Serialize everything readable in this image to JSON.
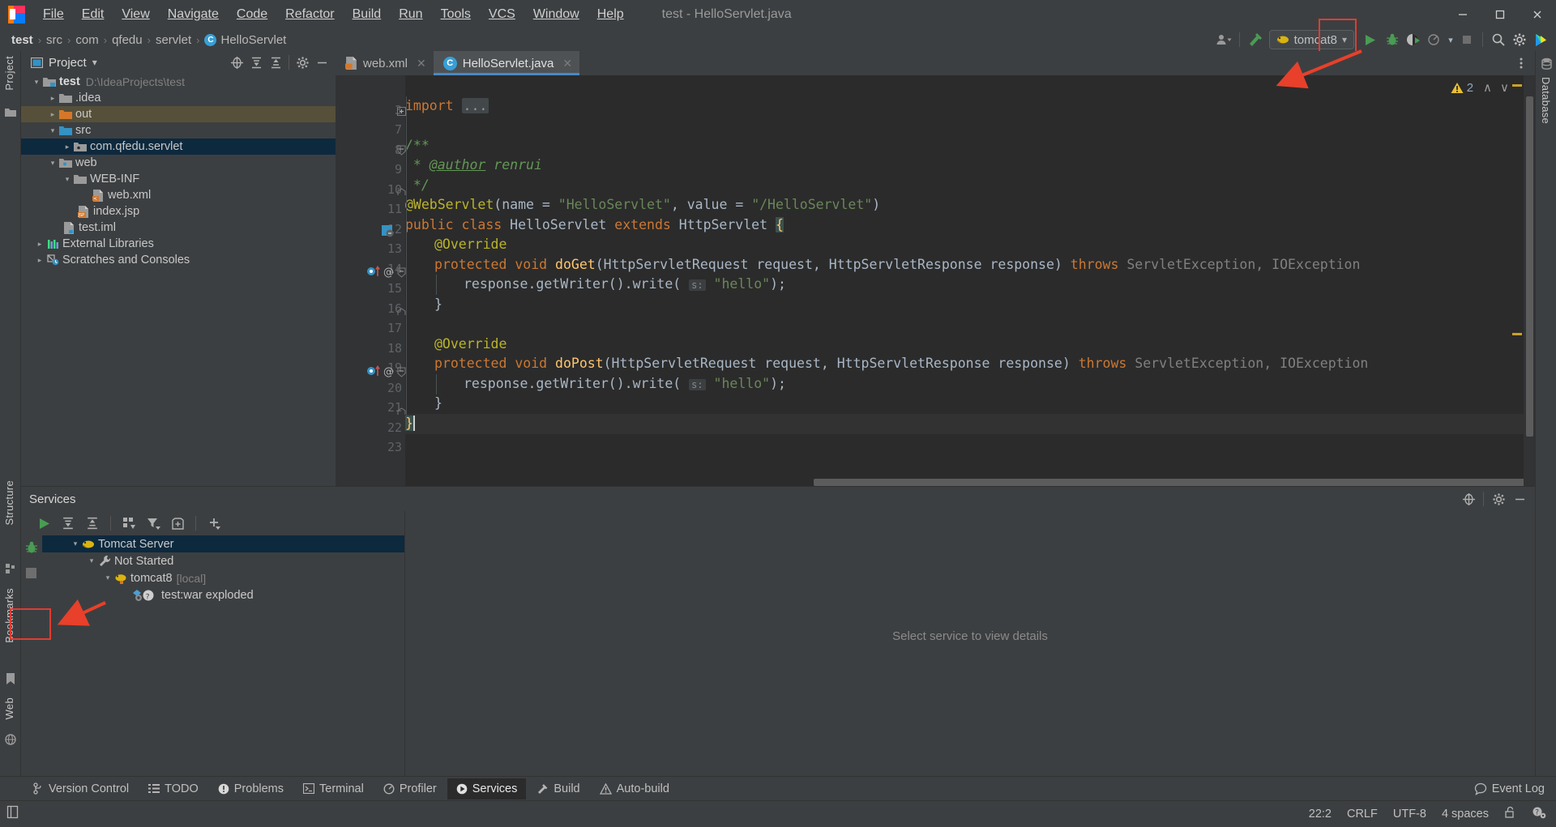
{
  "window": {
    "title": "test - HelloServlet.java",
    "app_icon": "intellij-idea-logo",
    "controls": {
      "minimize": "—",
      "maximize": "❐",
      "close": "✕"
    }
  },
  "menubar": {
    "items": [
      {
        "label": "File",
        "mnemonic": "F"
      },
      {
        "label": "Edit",
        "mnemonic": "E"
      },
      {
        "label": "View",
        "mnemonic": "V"
      },
      {
        "label": "Navigate",
        "mnemonic": "N"
      },
      {
        "label": "Code",
        "mnemonic": "C"
      },
      {
        "label": "Refactor",
        "mnemonic": "R"
      },
      {
        "label": "Build",
        "mnemonic": "B"
      },
      {
        "label": "Run",
        "mnemonic": "u"
      },
      {
        "label": "Tools",
        "mnemonic": "T"
      },
      {
        "label": "VCS",
        "mnemonic": "S"
      },
      {
        "label": "Window",
        "mnemonic": "W"
      },
      {
        "label": "Help",
        "mnemonic": "H"
      }
    ]
  },
  "breadcrumb": {
    "items": [
      "test",
      "src",
      "com",
      "qfedu",
      "servlet",
      "HelloServlet"
    ],
    "class_badge": "C",
    "separator": "›"
  },
  "toolbar": {
    "account_icon": "user-account-icon",
    "build_icon": "build-hammer-icon",
    "run_config": {
      "label": "tomcat8",
      "icon": "tomcat-icon",
      "chevron": "▾"
    },
    "run_button": "run-icon",
    "debug_button": "debug-bug-icon",
    "run_coverage_button": "run-with-coverage-icon",
    "profiler_button": "profiler-icon",
    "stop_button": "stop-icon",
    "search_button": "search-icon",
    "settings_button": "gear-icon",
    "updates_button": "idea-badge-icon",
    "highlight_color": "#e03c31"
  },
  "left_rail": {
    "top": [
      {
        "label": "Project",
        "icon": "folder-icon"
      }
    ],
    "bottom": [
      {
        "label": "Structure",
        "icon": "structure-icon"
      },
      {
        "label": "Bookmarks",
        "icon": "bookmark-icon"
      },
      {
        "label": "Web",
        "icon": "web-globe-icon"
      }
    ]
  },
  "right_rail": {
    "items": [
      {
        "label": "Database",
        "icon": "database-icon"
      }
    ]
  },
  "project_panel": {
    "title": "Project",
    "title_icon": "project-view-icon",
    "chevron": "▾",
    "header_icons": [
      "locate-target-icon",
      "expand-all-icon",
      "collapse-all-icon",
      "gear-icon",
      "minimize-icon"
    ],
    "tree": [
      {
        "label": "test",
        "detail": "D:\\IdeaProjects\\test",
        "depth": 0,
        "arrow": "down",
        "icon": "module-folder-icon",
        "bold": true,
        "state": "normal"
      },
      {
        "label": ".idea",
        "detail": "",
        "depth": 1,
        "arrow": "right",
        "icon": "folder-icon",
        "bold": false,
        "state": "normal"
      },
      {
        "label": "out",
        "detail": "",
        "depth": 1,
        "arrow": "right",
        "icon": "folder-orange-icon",
        "bold": false,
        "state": "highlight"
      },
      {
        "label": "src",
        "detail": "",
        "depth": 1,
        "arrow": "down",
        "icon": "source-folder-icon",
        "bold": false,
        "state": "normal"
      },
      {
        "label": "com.qfedu.servlet",
        "detail": "",
        "depth": 2,
        "arrow": "right",
        "icon": "package-icon",
        "bold": false,
        "state": "selected"
      },
      {
        "label": "web",
        "detail": "",
        "depth": 1,
        "arrow": "down",
        "icon": "web-resource-folder-icon",
        "bold": false,
        "state": "normal"
      },
      {
        "label": "WEB-INF",
        "detail": "",
        "depth": 2,
        "arrow": "down",
        "icon": "folder-icon",
        "bold": false,
        "state": "normal"
      },
      {
        "label": "web.xml",
        "detail": "",
        "depth": 3,
        "arrow": "none",
        "icon": "xml-file-icon",
        "bold": false,
        "state": "normal"
      },
      {
        "label": "index.jsp",
        "detail": "",
        "depth": 2,
        "arrow": "none",
        "icon": "jsp-file-icon",
        "bold": false,
        "state": "normal"
      },
      {
        "label": "test.iml",
        "detail": "",
        "depth": 1,
        "arrow": "none",
        "icon": "iml-file-icon",
        "bold": false,
        "state": "normal"
      },
      {
        "label": "External Libraries",
        "detail": "",
        "depth": 0,
        "arrow": "right",
        "icon": "libraries-icon",
        "bold": false,
        "state": "normal"
      },
      {
        "label": "Scratches and Consoles",
        "detail": "",
        "depth": 0,
        "arrow": "right",
        "icon": "scratches-icon",
        "bold": false,
        "state": "normal"
      }
    ]
  },
  "editor": {
    "tabs": [
      {
        "label": "web.xml",
        "icon": "xml-file-icon",
        "active": false,
        "close": "✕"
      },
      {
        "label": "HelloServlet.java",
        "icon": "java-class-icon",
        "active": true,
        "close": "✕"
      }
    ],
    "inspection": {
      "count": "2",
      "icon": "warning-triangle-icon",
      "up": "∧",
      "down": "∨"
    },
    "line_numbers": [
      "3",
      "7",
      "8",
      "9",
      "10",
      "11",
      "12",
      "13",
      "14",
      "15",
      "16",
      "17",
      "18",
      "19",
      "20",
      "21",
      "22",
      "23"
    ],
    "caret_line": "22",
    "code_lines": [
      {
        "n": "3",
        "indent": 0,
        "tokens": [
          {
            "t": "import ",
            "c": "k"
          },
          {
            "t": "...",
            "c": "fold"
          }
        ]
      },
      {
        "n": "7",
        "indent": 0,
        "tokens": []
      },
      {
        "n": "8",
        "indent": 0,
        "tokens": [
          {
            "t": "/**",
            "c": "c"
          }
        ]
      },
      {
        "n": "9",
        "indent": 0,
        "tokens": [
          {
            "t": " * ",
            "c": "c"
          },
          {
            "t": "@author",
            "c": "clink"
          },
          {
            "t": " renrui",
            "c": "c"
          }
        ]
      },
      {
        "n": "10",
        "indent": 0,
        "tokens": [
          {
            "t": " */",
            "c": "c"
          }
        ]
      },
      {
        "n": "11",
        "indent": 0,
        "tokens": [
          {
            "t": "@WebServlet",
            "c": "an"
          },
          {
            "t": "(name = ",
            "c": "p"
          },
          {
            "t": "\"HelloServlet\"",
            "c": "s"
          },
          {
            "t": ", value = ",
            "c": "p"
          },
          {
            "t": "\"/HelloServlet\"",
            "c": "s"
          },
          {
            "t": ")",
            "c": "p"
          }
        ]
      },
      {
        "n": "12",
        "indent": 0,
        "tokens": [
          {
            "t": "public class ",
            "c": "k"
          },
          {
            "t": "HelloServlet ",
            "c": "p"
          },
          {
            "t": "extends ",
            "c": "k"
          },
          {
            "t": "HttpServlet ",
            "c": "p"
          },
          {
            "t": "{",
            "c": "brace"
          }
        ]
      },
      {
        "n": "13",
        "indent": 1,
        "tokens": [
          {
            "t": "@Override",
            "c": "an"
          }
        ]
      },
      {
        "n": "14",
        "indent": 1,
        "tokens": [
          {
            "t": "protected void ",
            "c": "k"
          },
          {
            "t": "doGet",
            "c": "fn"
          },
          {
            "t": "(HttpServletRequest request, HttpServletResponse response) ",
            "c": "p"
          },
          {
            "t": "throws ",
            "c": "k"
          },
          {
            "t": "ServletException, IOException",
            "c": "dim"
          }
        ]
      },
      {
        "n": "15",
        "indent": 2,
        "tokens": [
          {
            "t": "response.getWriter().write( ",
            "c": "p"
          },
          {
            "t": "s:",
            "c": "hint"
          },
          {
            "t": " ",
            "c": "p"
          },
          {
            "t": "\"hello\"",
            "c": "s"
          },
          {
            "t": ");",
            "c": "p"
          }
        ]
      },
      {
        "n": "16",
        "indent": 1,
        "tokens": [
          {
            "t": "}",
            "c": "p"
          }
        ]
      },
      {
        "n": "17",
        "indent": 0,
        "tokens": []
      },
      {
        "n": "18",
        "indent": 1,
        "tokens": [
          {
            "t": "@Override",
            "c": "an"
          }
        ]
      },
      {
        "n": "19",
        "indent": 1,
        "tokens": [
          {
            "t": "protected void ",
            "c": "k"
          },
          {
            "t": "doPost",
            "c": "fn"
          },
          {
            "t": "(HttpServletRequest request, HttpServletResponse response) ",
            "c": "p"
          },
          {
            "t": "throws ",
            "c": "k"
          },
          {
            "t": "ServletException, IOException",
            "c": "dim"
          }
        ]
      },
      {
        "n": "20",
        "indent": 2,
        "tokens": [
          {
            "t": "response.getWriter().write( ",
            "c": "p"
          },
          {
            "t": "s:",
            "c": "hint"
          },
          {
            "t": " ",
            "c": "p"
          },
          {
            "t": "\"hello\"",
            "c": "s"
          },
          {
            "t": ");",
            "c": "p"
          }
        ]
      },
      {
        "n": "21",
        "indent": 1,
        "tokens": [
          {
            "t": "}",
            "c": "p"
          }
        ]
      },
      {
        "n": "22",
        "indent": 0,
        "tokens": [
          {
            "t": "}",
            "c": "brace"
          }
        ]
      },
      {
        "n": "23",
        "indent": 0,
        "tokens": []
      }
    ]
  },
  "services": {
    "title": "Services",
    "header_icons": [
      "locate-target-icon",
      "gear-icon",
      "minimize-icon"
    ],
    "toolbar_icons": [
      "run-icon",
      "expand-all-icon",
      "collapse-all-icon",
      "group-by-icon",
      "filter-icon",
      "show-configurations-icon",
      "add-icon"
    ],
    "side_icons": [
      "debug-bug-icon",
      "stop-icon"
    ],
    "tree": [
      {
        "label": "Tomcat Server",
        "detail": "",
        "depth": 0,
        "arrow": "down",
        "icon": "tomcat-icon",
        "state": "selected"
      },
      {
        "label": "Not Started",
        "detail": "",
        "depth": 1,
        "arrow": "down",
        "icon": "wrench-icon",
        "state": "normal"
      },
      {
        "label": "tomcat8",
        "detail": "[local]",
        "depth": 2,
        "arrow": "down",
        "icon": "tomcat-icon",
        "state": "normal"
      },
      {
        "label": "test:war exploded",
        "detail": "",
        "depth": 3,
        "arrow": "none",
        "icon": "artifact-icon",
        "state": "normal"
      }
    ],
    "detail_placeholder": "Select service to view details"
  },
  "toolwindow_bar": {
    "items": [
      {
        "label": "Version Control",
        "icon": "branch-icon",
        "active": false
      },
      {
        "label": "TODO",
        "icon": "todo-list-icon",
        "active": false
      },
      {
        "label": "Problems",
        "icon": "problems-icon",
        "active": false
      },
      {
        "label": "Terminal",
        "icon": "terminal-icon",
        "active": false
      },
      {
        "label": "Profiler",
        "icon": "profiler-icon",
        "active": false
      },
      {
        "label": "Services",
        "icon": "services-icon",
        "active": true
      },
      {
        "label": "Build",
        "icon": "build-hammer-icon",
        "active": false
      },
      {
        "label": "Auto-build",
        "icon": "warning-triangle-icon",
        "active": false
      }
    ],
    "event_log": {
      "label": "Event Log",
      "icon": "event-log-icon"
    }
  },
  "statusbar": {
    "left_icon": "toggle-toolwindows-icon",
    "caret_position": "22:2",
    "line_separator": "CRLF",
    "encoding": "UTF-8",
    "indent": "4 spaces",
    "lock_icon": "unlocked-icon",
    "inspection_icon": "inspection-profile-icon"
  },
  "annotations": {
    "arrow_color": "#e8402a",
    "arrows": [
      "points-at-run-button",
      "points-at-services-run-button"
    ]
  }
}
